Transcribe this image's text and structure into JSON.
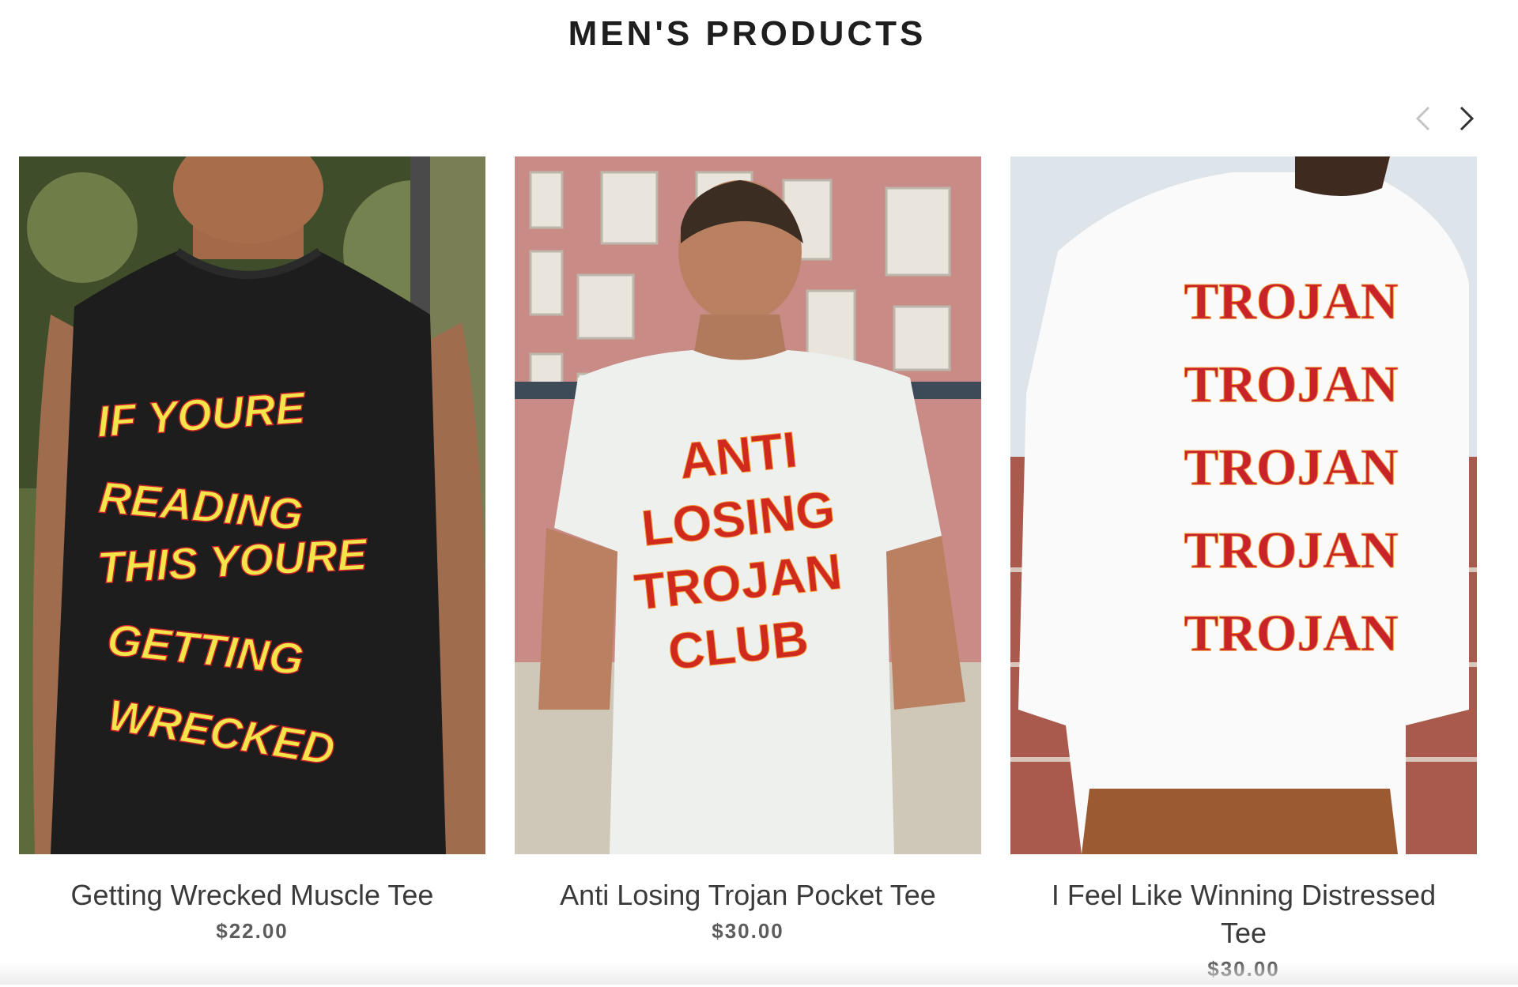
{
  "section": {
    "title": "MEN'S PRODUCTS"
  },
  "carousel": {
    "prev_icon": "chevron-left-icon",
    "next_icon": "chevron-right-icon"
  },
  "products": [
    {
      "name": "Getting Wrecked Muscle Tee",
      "price": "$22.00",
      "print_lines": [
        "IF YOURE",
        "READING",
        "THIS YOURE",
        "GETTING",
        "WRECKED"
      ]
    },
    {
      "name": "Anti Losing Trojan Pocket Tee",
      "price": "$30.00",
      "print_lines": [
        "ANTI",
        "LOSING",
        "TROJAN",
        "CLUB"
      ]
    },
    {
      "name": "I Feel Like Winning Distressed Tee",
      "price": "$30.00",
      "print_lines": [
        "TROJAN",
        "TROJAN",
        "TROJAN",
        "TROJAN",
        "TROJAN"
      ]
    }
  ],
  "colors": {
    "title": "#1e1e1e",
    "name": "#3a3a3a",
    "price": "#5c5c5c",
    "print_red": "#c8222a",
    "print_orange": "#f0923a",
    "print_yellow": "#f3e54a"
  }
}
